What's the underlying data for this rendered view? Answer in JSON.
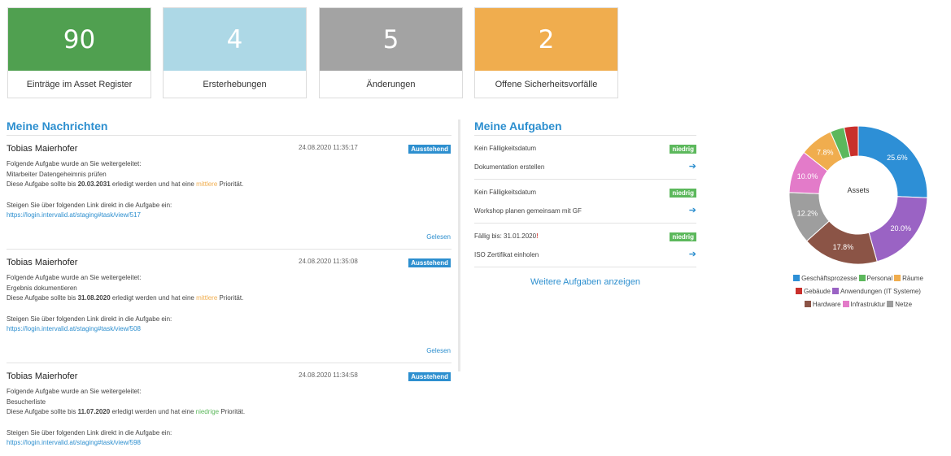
{
  "stats": [
    {
      "value": "90",
      "label": "Einträge im Asset Register",
      "color": "#50a050"
    },
    {
      "value": "4",
      "label": "Ersterhebungen",
      "color": "#add8e6"
    },
    {
      "value": "5",
      "label": "Änderungen",
      "color": "#a3a3a3"
    },
    {
      "value": "2",
      "label": "Offene Sicherheitsvorfälle",
      "color": "#f0ad4e"
    }
  ],
  "messages": {
    "title": "Meine Nachrichten",
    "items": [
      {
        "sender": "Tobias Maierhofer",
        "date": "24.08.2020 11:35:17",
        "badge": "Ausstehend",
        "line1": "Folgende Aufgabe wurde an Sie weitergeleitet:",
        "task": "Mitarbeiter Datengeheimnis prüfen",
        "due_prefix": "Diese Aufgabe sollte bis ",
        "due_date": "20.03.2031",
        "due_mid": " erledigt werden und hat eine ",
        "priority": "mittlere",
        "due_suffix": " Priorität.",
        "link_text": "Steigen Sie über folgenden Link direkt in die Aufgabe ein:",
        "link": "https://login.intervalid.at/staging#task/view/517",
        "read": "Gelesen"
      },
      {
        "sender": "Tobias Maierhofer",
        "date": "24.08.2020 11:35:08",
        "badge": "Ausstehend",
        "line1": "Folgende Aufgabe wurde an Sie weitergeleitet:",
        "task": "Ergebnis dokumentieren",
        "due_prefix": "Diese Aufgabe sollte bis ",
        "due_date": "31.08.2020",
        "due_mid": " erledigt werden und hat eine ",
        "priority": "mittlere",
        "due_suffix": " Priorität.",
        "link_text": "Steigen Sie über folgenden Link direkt in die Aufgabe ein:",
        "link": "https://login.intervalid.at/staging#task/view/508",
        "read": "Gelesen"
      },
      {
        "sender": "Tobias Maierhofer",
        "date": "24.08.2020 11:34:58",
        "badge": "Ausstehend",
        "line1": "Folgende Aufgabe wurde an Sie weitergeleitet:",
        "task": "Besucherliste",
        "due_prefix": "Diese Aufgabe sollte bis ",
        "due_date": "11.07.2020",
        "due_mid": " erledigt werden und hat eine ",
        "priority": "niedrige",
        "due_suffix": " Priorität.",
        "link_text": "Steigen Sie über folgenden Link direkt in die Aufgabe ein:",
        "link": "https://login.intervalid.at/staging#task/view/598"
      }
    ]
  },
  "tasks": {
    "title": "Meine Aufgaben",
    "items": [
      {
        "due": "Kein Fälligkeitsdatum",
        "priority": "niedrig",
        "name": "Dokumentation erstellen"
      },
      {
        "due": "Kein Fälligkeitsdatum",
        "priority": "niedrig",
        "name": "Workshop planen gemeinsam mit GF"
      },
      {
        "due": "Fällig bis: 31.01.2020",
        "overdue_mark": "!",
        "priority": "niedrig",
        "name": "ISO Zertifikat einholen"
      }
    ],
    "more": "Weitere Aufgaben anzeigen"
  },
  "chart_data": {
    "type": "pie",
    "center_label": "Assets",
    "slices": [
      {
        "name": "Geschäftsprozesse",
        "value": 25.6,
        "label": "25.6%",
        "color": "#2d8fd6"
      },
      {
        "name": "Anwendungen (IT Systeme)",
        "value": 20.0,
        "label": "20.0%",
        "color": "#9a63c4"
      },
      {
        "name": "Hardware",
        "value": 17.8,
        "label": "17.8%",
        "color": "#8b5446"
      },
      {
        "name": "Netze",
        "value": 12.2,
        "label": "12.2%",
        "color": "#9e9e9e"
      },
      {
        "name": "Infrastruktur",
        "value": 10.0,
        "label": "10.0%",
        "color": "#e37bc9"
      },
      {
        "name": "Räume",
        "value": 7.8,
        "label": "7.8%",
        "color": "#f0ad4e"
      },
      {
        "name": "Personal",
        "value": 3.3,
        "label": "",
        "color": "#5cb85c"
      },
      {
        "name": "Gebäude",
        "value": 3.3,
        "label": "",
        "color": "#c9302c"
      }
    ],
    "legend": [
      {
        "name": "Geschäftsprozesse",
        "color": "#2d8fd6"
      },
      {
        "name": "Personal",
        "color": "#5cb85c"
      },
      {
        "name": "Räume",
        "color": "#f0ad4e"
      },
      {
        "name": "Gebäude",
        "color": "#c9302c"
      },
      {
        "name": "Anwendungen (IT Systeme)",
        "color": "#9a63c4"
      },
      {
        "name": "Hardware",
        "color": "#8b5446"
      },
      {
        "name": "Infrastruktur",
        "color": "#e37bc9"
      },
      {
        "name": "Netze",
        "color": "#9e9e9e"
      }
    ]
  }
}
